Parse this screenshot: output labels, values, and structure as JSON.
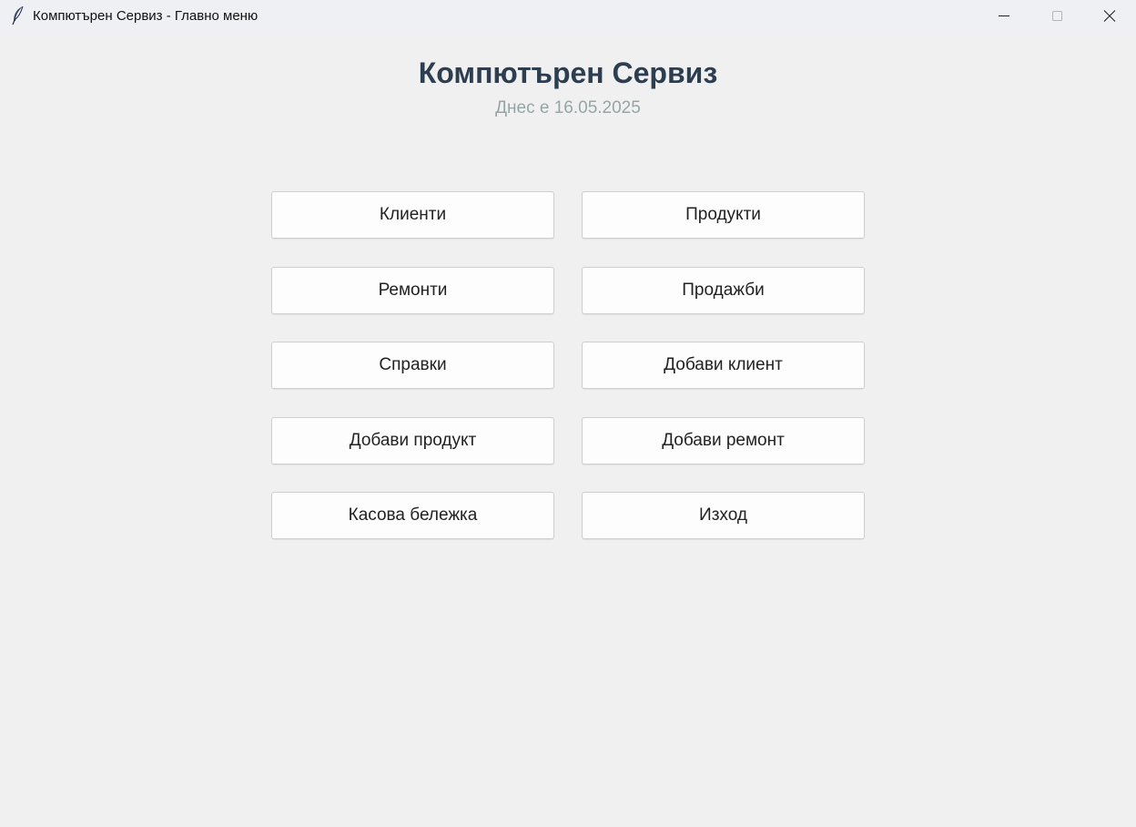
{
  "window": {
    "title": "Компютърен Сервиз - Главно меню",
    "icon": "feather-icon"
  },
  "header": {
    "title": "Компютърен Сервиз",
    "date_text": "Днес е 16.05.2025"
  },
  "menu": {
    "clients": "Клиенти",
    "products": "Продукти",
    "repairs": "Ремонти",
    "sales": "Продажби",
    "reports": "Справки",
    "add_client": "Добави клиент",
    "add_product": "Добави продукт",
    "add_repair": "Добави ремонт",
    "receipt": "Касова бележка",
    "exit": "Изход"
  },
  "colors": {
    "title": "#2c3e50",
    "date": "#95a5a6",
    "background": "#f0f0f0"
  }
}
